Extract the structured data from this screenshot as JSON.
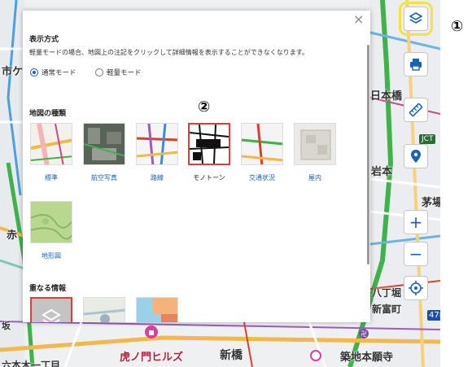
{
  "map": {
    "labels": {
      "shiba_top": "市ケ",
      "nihonbashi": "日本橋",
      "ake": "赤",
      "iwamoto": "岩本",
      "kaya": "茅場",
      "ban": "坂",
      "kyobashi_area": "八丁堀",
      "toranomon_hills": "虎ノ門ヒルズ",
      "shimbashi": "新橋",
      "tsukiji": "築地本願寺",
      "roppongi": "六本木一丁目",
      "shintomi": "新富町"
    },
    "route_badge": "478",
    "jct_badge": "JCT"
  },
  "toolbar": {
    "layers": "layers-icon",
    "print": "print-icon",
    "measure": "ruler-icon",
    "location": "pin-icon",
    "zoom_in": "+",
    "zoom_out": "−",
    "current_location": "target-icon",
    "highlight_color": "#f3e43a"
  },
  "callouts": {
    "one": "①",
    "two": "②"
  },
  "dialog": {
    "close": "×",
    "display_mode": {
      "title": "表示方式",
      "description": "軽量モードの場合、地図上の注記をクリックして詳細情報を表示することができなくなります。",
      "options": [
        "通常モード",
        "軽量モード"
      ],
      "selected": "通常モード"
    },
    "map_types": {
      "title": "地図の種類",
      "items": [
        {
          "label": "標準"
        },
        {
          "label": "航空写真"
        },
        {
          "label": "路線"
        },
        {
          "label": "モノトーン"
        },
        {
          "label": "交通状況"
        },
        {
          "label": "屋内"
        },
        {
          "label": "地形図"
        }
      ],
      "selected": "モノトーン"
    },
    "overlay": {
      "title": "重なる情報"
    }
  },
  "colors": {
    "accent": "#1b62b5",
    "selected_border": "#e23b3b"
  }
}
